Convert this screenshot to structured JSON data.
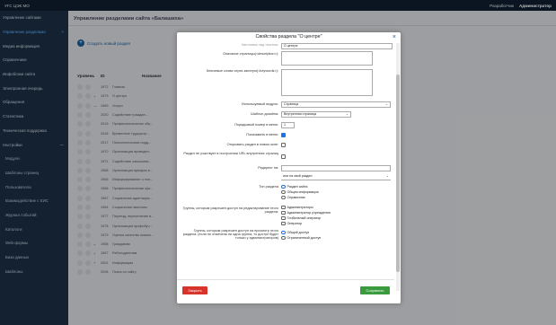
{
  "topbar": {
    "title": "УГС ЦЭК МО",
    "developer": "Разработчик",
    "admin": "Администратор"
  },
  "sidebar": {
    "items": [
      {
        "label": "Управление сайтами",
        "arrow": ""
      },
      {
        "label": "Управление разделами",
        "arrow": ">"
      },
      {
        "label": "Медиа информация",
        "arrow": ""
      },
      {
        "label": "Справочники",
        "arrow": ""
      },
      {
        "label": "Инфоблоки сайта",
        "arrow": ""
      },
      {
        "label": "Электронная очередь",
        "arrow": ""
      },
      {
        "label": "Обращения",
        "arrow": ""
      },
      {
        "label": "Статистика",
        "arrow": ""
      },
      {
        "label": "Техническая поддержка",
        "arrow": ""
      },
      {
        "label": "Настройки",
        "arrow": "—"
      },
      {
        "label": "Модули",
        "arrow": ""
      },
      {
        "label": "Шаблоны страниц",
        "arrow": ""
      },
      {
        "label": "Пользователи",
        "arrow": ""
      },
      {
        "label": "Взаимодействие с ЕИС",
        "arrow": ""
      },
      {
        "label": "Журнал событий",
        "arrow": ""
      },
      {
        "label": "Каталоги",
        "arrow": ""
      },
      {
        "label": "Web-формы",
        "arrow": ""
      },
      {
        "label": "База данных",
        "arrow": ""
      },
      {
        "label": "Шаблоны",
        "arrow": ""
      }
    ]
  },
  "main": {
    "title": "Управление разделами сайта «Балашиха»",
    "create_label": "Создать новый раздел",
    "col_level": "Уровень",
    "col_id": "ID",
    "col_name": "Название"
  },
  "rows": [
    {
      "exp": "",
      "id": "1972",
      "name": "Главная"
    },
    {
      "exp": "+",
      "id": "1973",
      "name": "О центре"
    },
    {
      "exp": "—",
      "id": "1969",
      "name": "Услуги"
    },
    {
      "exp": "",
      "id": "2020",
      "name": "Содействие граждан..."
    },
    {
      "exp": "",
      "id": "2019",
      "name": "Профессиональное обу..."
    },
    {
      "exp": "",
      "id": "2018",
      "name": "Временное трудоустр..."
    },
    {
      "exp": "",
      "id": "2017",
      "name": "Психологическая подд..."
    },
    {
      "exp": "",
      "id": "1970",
      "name": "Организация проведен..."
    },
    {
      "exp": "",
      "id": "1971",
      "name": "Содействие самозанят..."
    },
    {
      "exp": "",
      "id": "1968",
      "name": "Организация ярмарок в..."
    },
    {
      "exp": "",
      "id": "1965",
      "name": "Информирование о пол..."
    },
    {
      "exp": "",
      "id": "1966",
      "name": "Профессиональная ори..."
    },
    {
      "exp": "",
      "id": "1967",
      "name": "Социальная адаптация..."
    },
    {
      "exp": "",
      "id": "1964",
      "name": "Социальные выплаты"
    },
    {
      "exp": "",
      "id": "1977",
      "name": "Переезд, переселение в..."
    },
    {
      "exp": "",
      "id": "1978",
      "name": "Организация профобуч..."
    },
    {
      "exp": "",
      "id": "1979",
      "name": "Оценка качества оказан..."
    },
    {
      "exp": "+",
      "id": "1958",
      "name": "Гражданам"
    },
    {
      "exp": "+",
      "id": "1967",
      "name": "Работодателям"
    },
    {
      "exp": "+",
      "id": "2001",
      "name": "Информация"
    },
    {
      "exp": "",
      "id": "2008",
      "name": "Поиск по сайту"
    }
  ],
  "modal": {
    "title": "Свойства раздела \"О центре\"",
    "close_icon": "×",
    "top_label": "Заголовок над текстом:",
    "top_value": "О центре",
    "desc_label": "Описание страницы(<description>):",
    "keywords_label": "Ключевые слова через запятую(<keywords>):",
    "module_label": "Используемый модуль:",
    "module_value": "Страница",
    "template_label": "Шаблон дизайна:",
    "template_value": "Внутренняя страница",
    "order_label": "Порядковый номер в меню:",
    "order_value": "1",
    "show_menu_label": "Показывать в меню:",
    "new_window_label": "Открывать раздел в новом окне:",
    "no_url_label": "Раздел не участвует в построении URL внутренних страниц",
    "redirect_label": "Редирект на:",
    "redirect_alt": "или на свой раздел:",
    "type_label": "Тип раздела",
    "type_options": [
      "Раздел сайта",
      "Общая информация",
      "Справочник"
    ],
    "edit_groups_label": "Группы, которым разрешен доступ на редактирование этого раздела:",
    "edit_groups": [
      "Администраторы",
      "Администратор учреждения",
      "Глобальный оператор",
      "Оператор"
    ],
    "view_groups_label": "Группы, которым разрешен доступ на просмотр этого раздела: (если не отмечена ни одна группа, то доступ будет только у администраторов)",
    "view_options": [
      "Общий доступ",
      "Ограниченный доступ"
    ],
    "btn_close": "Закрыть",
    "btn_save": "Сохранить"
  }
}
